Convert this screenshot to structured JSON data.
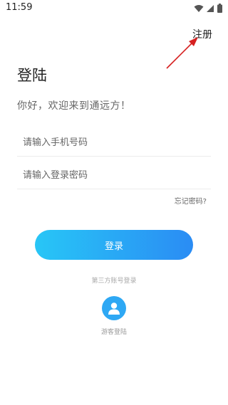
{
  "status_bar": {
    "time": "11:59",
    "icons": [
      "wifi-icon",
      "signal-icon",
      "battery-icon"
    ]
  },
  "header": {
    "register_label": "注册"
  },
  "main": {
    "title": "登陆",
    "welcome": "你好，欢迎来到通远方！",
    "phone_input": {
      "placeholder": "请输入手机号码",
      "value": ""
    },
    "password_input": {
      "placeholder": "请输入登录密码",
      "value": ""
    },
    "forgot_label": "忘记密码?",
    "login_label": "登录",
    "third_party_label": "第三方账号登录",
    "guest_icon": "user-icon",
    "guest_label": "游客登陆"
  },
  "colors": {
    "button_gradient_start": "#28c6f6",
    "button_gradient_end": "#2a8cf4",
    "guest_avatar": "#2ea8f4",
    "annotation_arrow": "#d62020"
  }
}
